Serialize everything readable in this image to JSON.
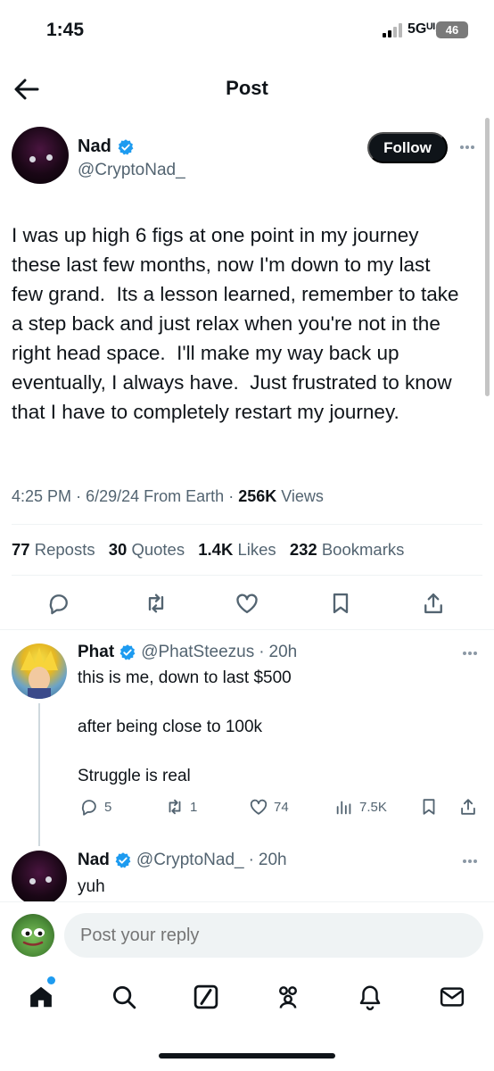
{
  "status_bar": {
    "time": "1:45",
    "network": "5Gᵁᴵᴞ",
    "battery": "46"
  },
  "header": {
    "title": "Post"
  },
  "post": {
    "author_name": "Nad",
    "author_handle": "@CryptoNad_",
    "follow_label": "Follow",
    "text": "I was up high 6 figs at one point in my journey these last few months, now I'm down to my last few grand.  Its a lesson learned, remember to take a step back and just relax when you're not in the right head space.  I'll make my way back up eventually, I always have.  Just frustrated to know that I have to completely restart my journey.",
    "time": "4:25 PM",
    "date": "6/29/24",
    "source": "From Earth",
    "views_count": "256K",
    "views_label": "Views",
    "reposts_count": "77",
    "reposts_label": "Reposts",
    "quotes_count": "30",
    "quotes_label": "Quotes",
    "likes_count": "1.4K",
    "likes_label": "Likes",
    "bookmarks_count": "232",
    "bookmarks_label": "Bookmarks"
  },
  "replies": [
    {
      "name": "Phat",
      "handle": "@PhatSteezus",
      "age": "20h",
      "line1": "this is me, down to last $500",
      "line2": "after being close to 100k",
      "line3": "Struggle is real",
      "replies": "5",
      "reposts": "1",
      "likes": "74",
      "views": "7.5K"
    },
    {
      "name": "Nad",
      "handle": "@CryptoNad_",
      "age": "20h",
      "line1": "yuh"
    }
  ],
  "composer": {
    "placeholder": "Post your reply"
  },
  "colors": {
    "verified": "#1d9bf0",
    "text": "#0f1419",
    "muted": "#536471",
    "divider": "#eff3f4"
  }
}
